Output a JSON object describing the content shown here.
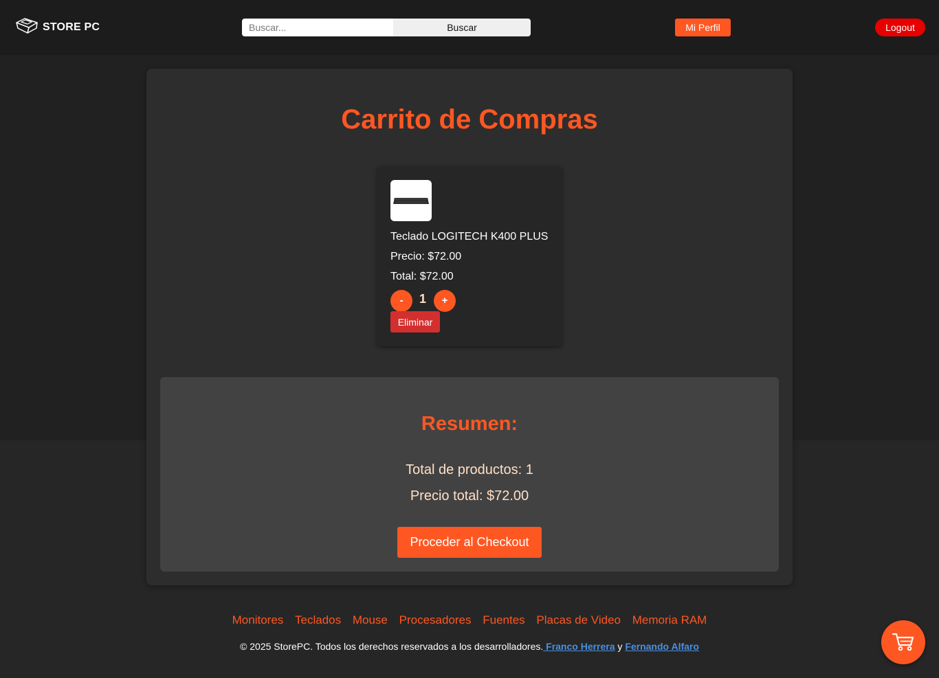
{
  "header": {
    "brand": "STORE PC",
    "search_placeholder": "Buscar...",
    "search_button": "Buscar",
    "profile_button": "Mi Perfil",
    "logout_button": "Logout"
  },
  "cart": {
    "title": "Carrito de Compras",
    "items": [
      {
        "name": "Teclado LOGITECH K400 PLUS",
        "price": "Precio: $72.00",
        "total": "Total: $72.00",
        "quantity": "1",
        "decrease_label": "-",
        "increase_label": "+",
        "remove_label": "Eliminar",
        "image_icon": "keyboard-icon"
      }
    ]
  },
  "summary": {
    "title": "Resumen:",
    "count": "Total de productos: 1",
    "price": "Precio total: $72.00",
    "checkout_button": "Proceder al Checkout"
  },
  "footer": {
    "nav": [
      "Monitores",
      "Teclados",
      "Mouse",
      "Procesadores",
      "Fuentes",
      "Placas de Video",
      "Memoria RAM"
    ],
    "copyright_prefix": "© 2025 StorePC. Todos los derechos reservados a los desarrolladores.",
    "author1": " Franco Herrera",
    "separator": " y ",
    "author2": "Fernando Alfaro"
  },
  "cart_fab_icon": "cart-icon",
  "colors": {
    "accent": "#ff5722",
    "danger": "#d32f2f",
    "logout": "#e60000",
    "background": "#212121",
    "link": "#4a90e2"
  }
}
